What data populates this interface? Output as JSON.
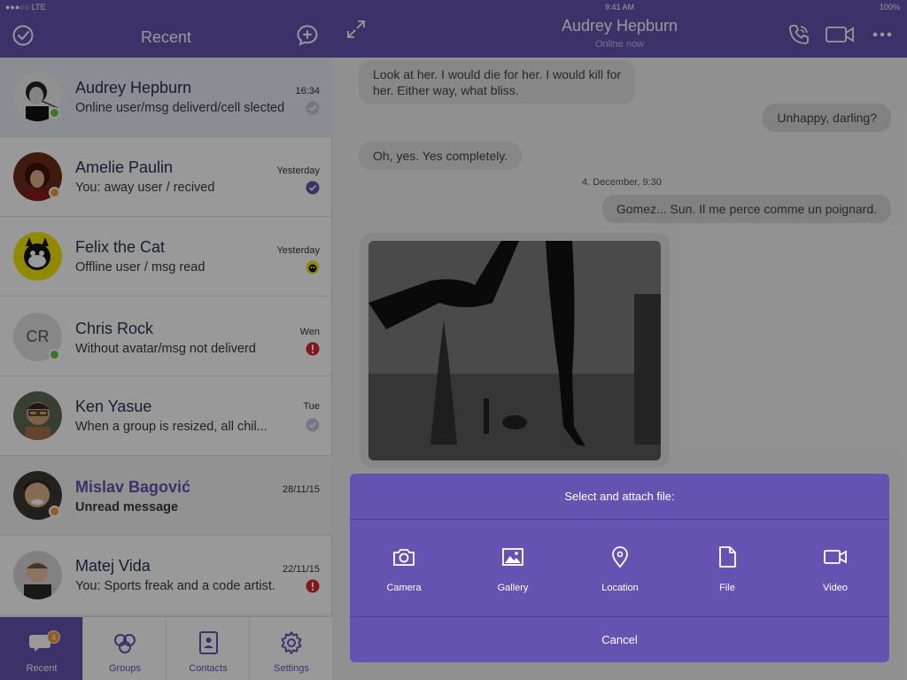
{
  "status_bar": {
    "carrier": "●●●○○ LTE",
    "time": "9:41 AM",
    "battery": "100%"
  },
  "sidebar": {
    "title": "Recent",
    "chats": [
      {
        "name": "Audrey Hepburn",
        "message": "Online user/msg deliverd/cell slected",
        "time": "16:34",
        "presence": "online",
        "status": "delivered"
      },
      {
        "name": "Amelie Paulin",
        "message": "You: away user / recived",
        "time": "Yesterday",
        "presence": "away",
        "status": "received"
      },
      {
        "name": "Felix the Cat",
        "message": "Offline user / msg read",
        "time": "Yesterday",
        "presence": "offline",
        "status": "read"
      },
      {
        "name": "Chris Rock",
        "initials": "CR",
        "message": "Without avatar/msg not deliverd",
        "time": "Wen",
        "presence": "online",
        "status": "error"
      },
      {
        "name": "Ken Yasue",
        "message": "When a group is resized, all chil...",
        "time": "Tue",
        "presence": "offline",
        "status": "delivered"
      },
      {
        "name": "Mislav Bagović",
        "message": "Unread message",
        "time": "28/11/15",
        "presence": "away",
        "status": "unread"
      },
      {
        "name": "Matej Vida",
        "message": "You: Sports freak and a code artist.",
        "time": "22/11/15",
        "presence": "offline",
        "status": "error"
      }
    ]
  },
  "tabs": [
    {
      "label": "Recent",
      "badge": "4",
      "icon": "chat-bubble-icon"
    },
    {
      "label": "Groups",
      "icon": "groups-icon"
    },
    {
      "label": "Contacts",
      "icon": "contacts-icon"
    },
    {
      "label": "Settings",
      "icon": "gear-icon"
    }
  ],
  "conversation": {
    "name": "Audrey Hepburn",
    "status": "Online now",
    "messages": [
      {
        "text": "Look at her. I would die for her. I would kill for",
        "text2": "her. Either way, what bliss.",
        "direction": "in"
      },
      {
        "text": "Unhappy, darling?",
        "direction": "out"
      },
      {
        "text": "Oh, yes. Yes completely.",
        "direction": "in"
      },
      {
        "text": "Gomez... Sun. Il me perce comme un poignard.",
        "direction": "out"
      }
    ],
    "date_separator": "4. December, 9:30"
  },
  "attach_sheet": {
    "title": "Select and attach file:",
    "options": [
      {
        "label": "Camera",
        "icon": "camera-icon"
      },
      {
        "label": "Gallery",
        "icon": "image-icon"
      },
      {
        "label": "Location",
        "icon": "location-pin-icon"
      },
      {
        "label": "File",
        "icon": "file-icon"
      },
      {
        "label": "Video",
        "icon": "video-icon"
      }
    ],
    "cancel": "Cancel"
  },
  "colors": {
    "brand": "#6652b0",
    "online": "#6cc04a",
    "away": "#f39c32",
    "error": "#d9262c"
  }
}
